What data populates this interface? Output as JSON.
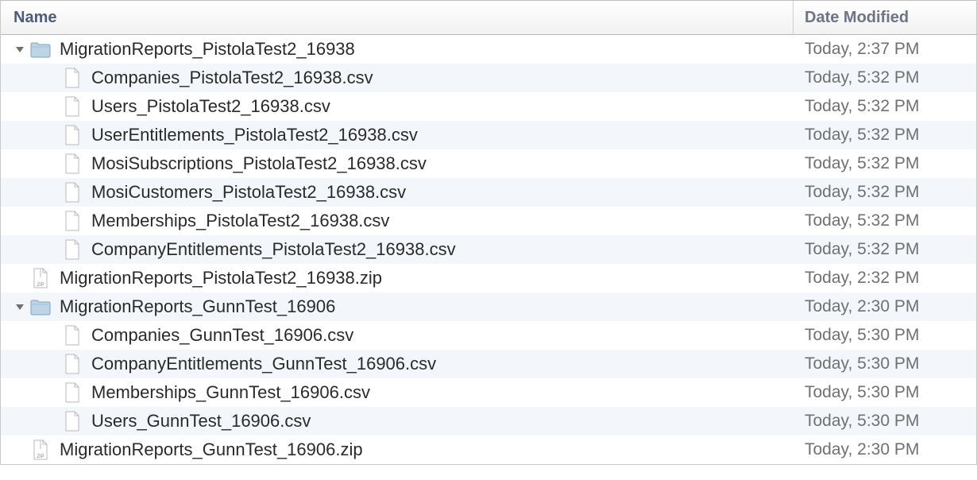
{
  "header": {
    "name": "Name",
    "date": "Date Modified"
  },
  "rows": [
    {
      "type": "folder",
      "expanded": true,
      "depth": 0,
      "name": "MigrationReports_PistolaTest2_16938",
      "date": "Today, 2:37 PM"
    },
    {
      "type": "file",
      "depth": 1,
      "name": "Companies_PistolaTest2_16938.csv",
      "date": "Today, 5:32 PM"
    },
    {
      "type": "file",
      "depth": 1,
      "name": "Users_PistolaTest2_16938.csv",
      "date": "Today, 5:32 PM"
    },
    {
      "type": "file",
      "depth": 1,
      "name": "UserEntitlements_PistolaTest2_16938.csv",
      "date": "Today, 5:32 PM"
    },
    {
      "type": "file",
      "depth": 1,
      "name": "MosiSubscriptions_PistolaTest2_16938.csv",
      "date": "Today, 5:32 PM"
    },
    {
      "type": "file",
      "depth": 1,
      "name": "MosiCustomers_PistolaTest2_16938.csv",
      "date": "Today, 5:32 PM"
    },
    {
      "type": "file",
      "depth": 1,
      "name": "Memberships_PistolaTest2_16938.csv",
      "date": "Today, 5:32 PM"
    },
    {
      "type": "file",
      "depth": 1,
      "name": "CompanyEntitlements_PistolaTest2_16938.csv",
      "date": "Today, 5:32 PM"
    },
    {
      "type": "zip",
      "depth": 0,
      "name": "MigrationReports_PistolaTest2_16938.zip",
      "date": "Today, 2:32 PM"
    },
    {
      "type": "folder",
      "expanded": true,
      "depth": 0,
      "name": "MigrationReports_GunnTest_16906",
      "date": "Today, 2:30 PM"
    },
    {
      "type": "file",
      "depth": 1,
      "name": "Companies_GunnTest_16906.csv",
      "date": "Today, 5:30 PM"
    },
    {
      "type": "file",
      "depth": 1,
      "name": "CompanyEntitlements_GunnTest_16906.csv",
      "date": "Today, 5:30 PM"
    },
    {
      "type": "file",
      "depth": 1,
      "name": "Memberships_GunnTest_16906.csv",
      "date": "Today, 5:30 PM"
    },
    {
      "type": "file",
      "depth": 1,
      "name": "Users_GunnTest_16906.csv",
      "date": "Today, 5:30 PM"
    },
    {
      "type": "zip",
      "depth": 0,
      "name": "MigrationReports_GunnTest_16906.zip",
      "date": "Today, 2:30 PM"
    }
  ]
}
